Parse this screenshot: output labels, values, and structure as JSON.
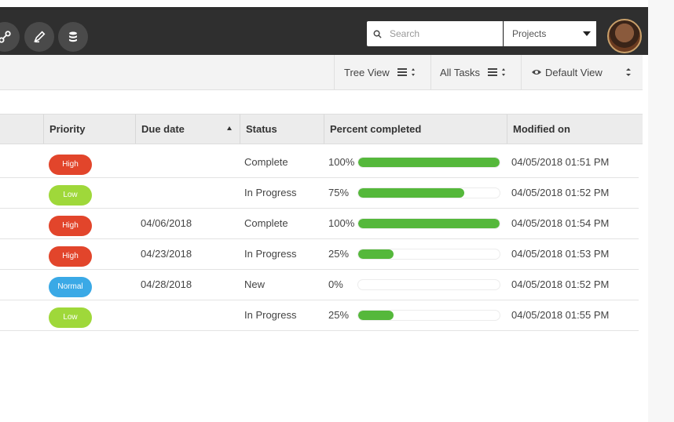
{
  "search": {
    "placeholder": "Search"
  },
  "project_select": {
    "value": "Projects"
  },
  "toolbar": {
    "tree_view": "Tree View",
    "all_tasks": "All Tasks",
    "default_view": "Default View"
  },
  "table": {
    "headers": {
      "priority": "Priority",
      "due_date": "Due date",
      "status": "Status",
      "percent": "Percent completed",
      "modified": "Modified on"
    },
    "rows": [
      {
        "priority": "High",
        "priority_color": "#e2452b",
        "due": "",
        "status": "Complete",
        "percent_label": "100%",
        "percent": 100,
        "modified": "04/05/2018 01:51 PM"
      },
      {
        "priority": "Low",
        "priority_color": "#9fd83a",
        "due": "",
        "status": "In Progress",
        "percent_label": "75%",
        "percent": 75,
        "modified": "04/05/2018 01:52 PM"
      },
      {
        "priority": "High",
        "priority_color": "#e2452b",
        "due": "04/06/2018",
        "status": "Complete",
        "percent_label": "100%",
        "percent": 100,
        "modified": "04/05/2018 01:54 PM"
      },
      {
        "priority": "High",
        "priority_color": "#e2452b",
        "due": "04/23/2018",
        "status": "In Progress",
        "percent_label": "25%",
        "percent": 25,
        "modified": "04/05/2018 01:53 PM"
      },
      {
        "priority": "Normal",
        "priority_color": "#3aa9e6",
        "due": "04/28/2018",
        "status": "New",
        "percent_label": "0%",
        "percent": 0,
        "modified": "04/05/2018 01:52 PM"
      },
      {
        "priority": "Low",
        "priority_color": "#9fd83a",
        "due": "",
        "status": "In Progress",
        "percent_label": "25%",
        "percent": 25,
        "modified": "04/05/2018 01:55 PM"
      }
    ]
  },
  "icons": {
    "toolbar_buttons": [
      "link-icon",
      "pen-icon",
      "database-icon"
    ],
    "search": "search-icon",
    "eye": "eye-icon"
  },
  "colors": {
    "topbar": "#2f2f2f",
    "progress": "#55b83b"
  }
}
